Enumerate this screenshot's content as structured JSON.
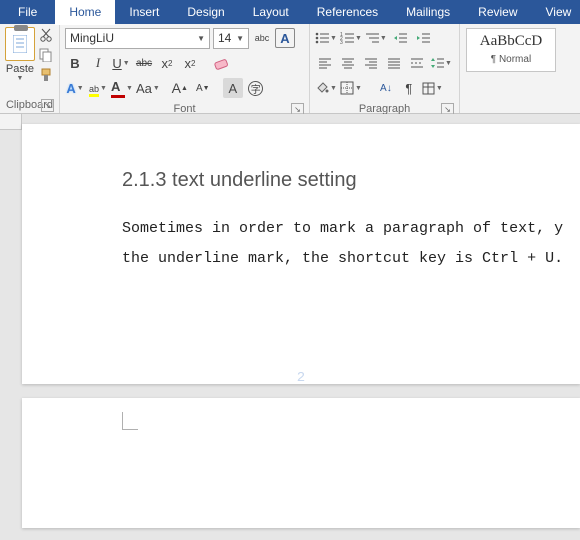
{
  "tabs": {
    "file": "File",
    "home": "Home",
    "insert": "Insert",
    "design": "Design",
    "layout": "Layout",
    "references": "References",
    "mailings": "Mailings",
    "review": "Review",
    "view": "View"
  },
  "clipboard": {
    "paste": "Paste",
    "group_label": "Clipboard"
  },
  "font": {
    "name": "MingLiU",
    "size": "14",
    "group_label": "Font",
    "bold": "B",
    "italic": "I",
    "underline": "U",
    "strike": "abc",
    "subscript": "x",
    "subscript_small": "2",
    "superscript": "x",
    "superscript_small": "2",
    "grow": "A",
    "shrink": "A",
    "case": "Aa",
    "clear": "A",
    "char_border": "A",
    "font_color": "A",
    "char_shading": "A",
    "text_effects": "A"
  },
  "paragraph": {
    "group_label": "Paragraph"
  },
  "styles": {
    "sample": "AaBbCcD",
    "name": "¶ Normal"
  },
  "document": {
    "heading": "2.1.3 text underline setting",
    "body_line1": "Sometimes in order to mark a paragraph of text, y",
    "body_line2": "the underline mark, the shortcut key is Ctrl + U.",
    "page_number": "2"
  }
}
